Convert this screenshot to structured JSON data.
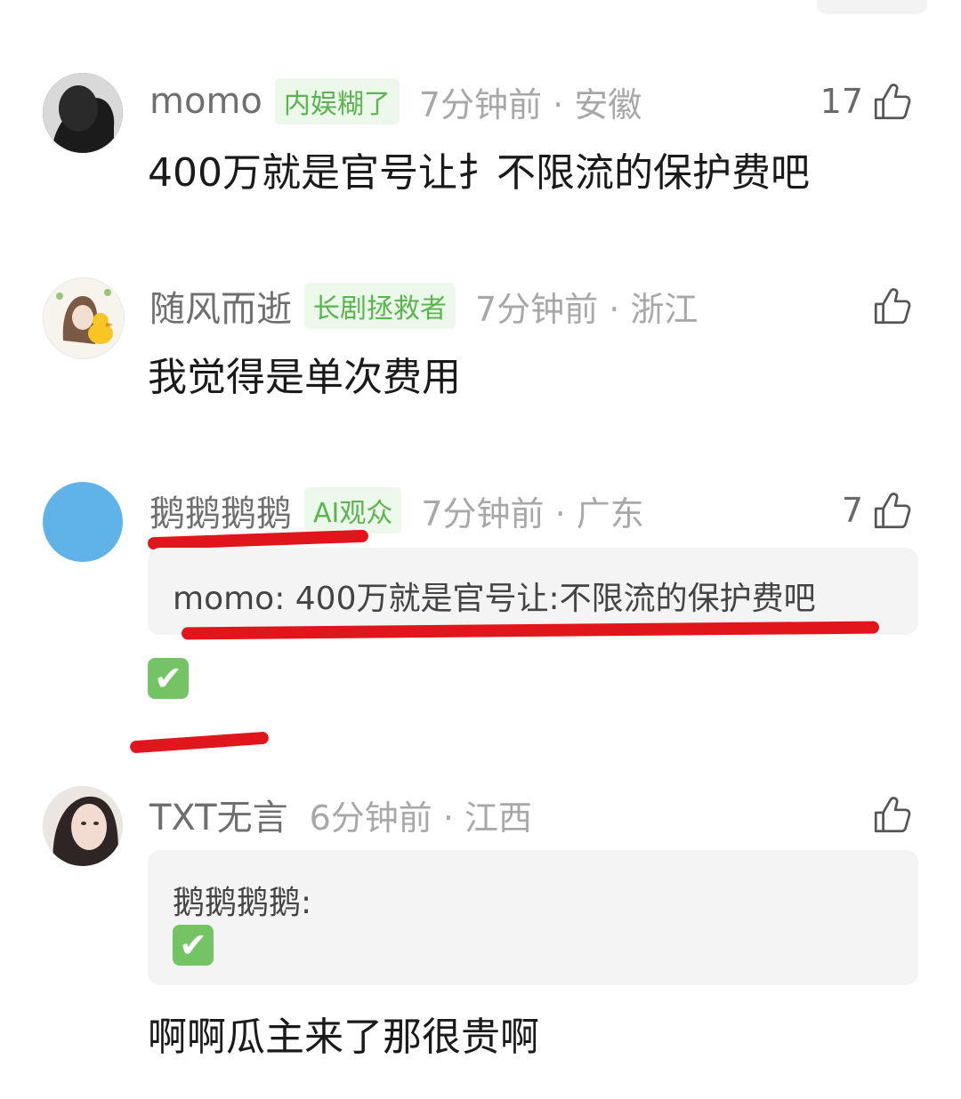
{
  "comments": [
    {
      "username": "momo",
      "badge": "内娱糊了",
      "time": "7分钟前 · 安徽",
      "likes": "17",
      "text": "400万就是官号让扌不限流的保护费吧"
    },
    {
      "username": "随风而逝",
      "badge": "长剧拯救者",
      "time": "7分钟前 · 浙江",
      "likes": "",
      "text": "我觉得是单次费用"
    },
    {
      "username": "鹅鹅鹅鹅",
      "badge": "AI观众",
      "time": "7分钟前 · 广东",
      "likes": "7",
      "quote": "momo: 400万就是官号让:不限流的保护费吧",
      "emoji": "✔"
    },
    {
      "username": "TXT无言",
      "badge": "",
      "time": "6分钟前 · 江西",
      "likes": "",
      "quote_author": "鹅鹅鹅鹅:",
      "quote_emoji": "✔",
      "text": "啊啊瓜主来了那很贵啊"
    }
  ],
  "colors": {
    "badge_green": "#5bb451",
    "annotation_red": "#e0161c",
    "check_green": "#74c365"
  },
  "icons": [
    "thumbs-up-icon",
    "check-mark-icon"
  ]
}
